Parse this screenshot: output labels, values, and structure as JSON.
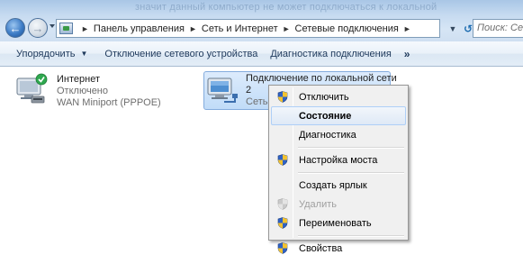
{
  "header": {
    "ghost_text": "значит данный компьютер не может подключаться к локальной"
  },
  "breadcrumbs": [
    "Панель управления",
    "Сеть и Интернет",
    "Сетевые подключения"
  ],
  "search": {
    "placeholder": "Поиск: Сете..."
  },
  "toolbar": {
    "organize_label": "Упорядочить",
    "disable_label": "Отключение сетевого устройства",
    "diagnostics_label": "Диагностика подключения",
    "more_label": "»"
  },
  "connections": [
    {
      "name": "Интернет",
      "status": "Отключено",
      "device": "WAN Miniport (PPPOE)",
      "icon": "dialup-connection-icon",
      "status_color": "#2fa84f"
    },
    {
      "name": "Подключение по локальной сети",
      "status": "2",
      "device": "Сеть",
      "icon": "lan-connection-icon"
    }
  ],
  "context_menu": {
    "items": [
      {
        "label": "Отключить",
        "shield": true,
        "bold": false,
        "disabled": false
      },
      {
        "label": "Состояние",
        "shield": false,
        "bold": true,
        "disabled": false,
        "hover": true
      },
      {
        "label": "Диагностика",
        "shield": false,
        "bold": false,
        "disabled": false
      },
      {
        "label": "Настройка моста",
        "shield": true,
        "bold": false,
        "disabled": false
      },
      {
        "label": "Создать ярлык",
        "shield": false,
        "bold": false,
        "disabled": false
      },
      {
        "label": "Удалить",
        "shield": true,
        "bold": false,
        "disabled": true
      },
      {
        "label": "Переименовать",
        "shield": true,
        "bold": false,
        "disabled": false
      },
      {
        "label": "Свойства",
        "shield": true,
        "bold": false,
        "disabled": false
      }
    ]
  },
  "colors": {
    "accent": "#3d7cc6",
    "selection": "#c1dcf8",
    "shield_blue": "#2f62c4",
    "shield_yellow": "#f2c230"
  }
}
